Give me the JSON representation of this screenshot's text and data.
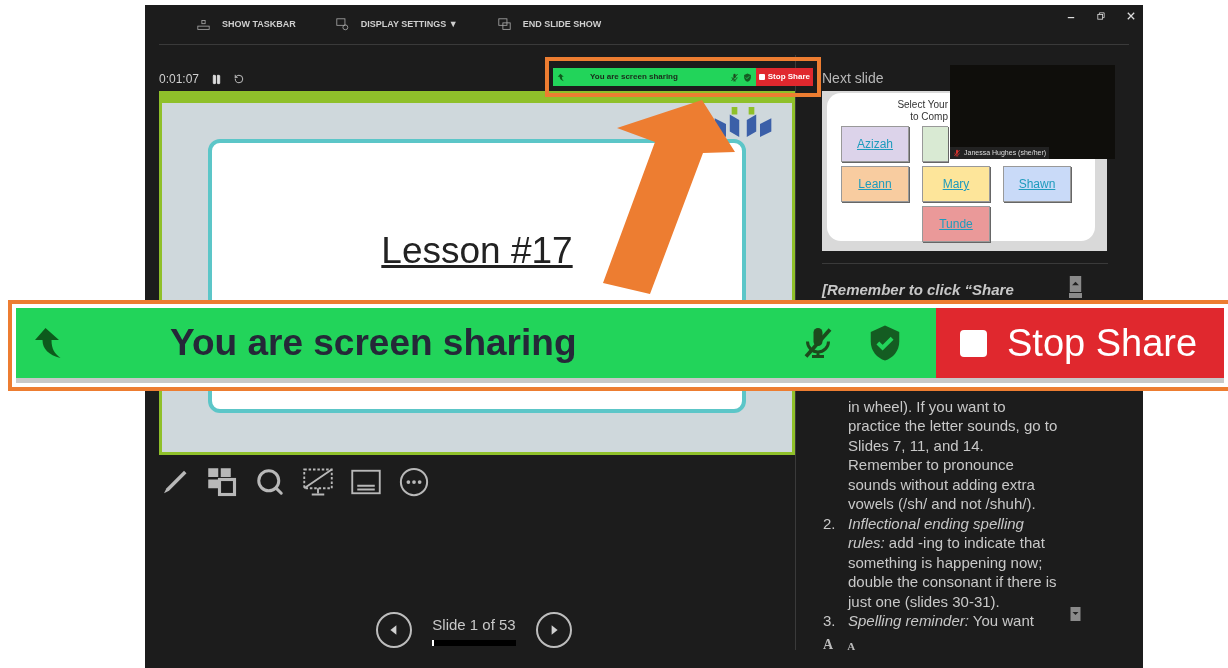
{
  "window": {
    "toolbar": [
      {
        "kind": "taskbar",
        "label": "SHOW TASKBAR"
      },
      {
        "kind": "display",
        "label": "DISPLAY SETTINGS ▼"
      },
      {
        "kind": "end",
        "label": "END SLIDE SHOW"
      }
    ]
  },
  "timer": {
    "time": "0:01:07"
  },
  "current_slide": {
    "title": "Lesson #17"
  },
  "navigation": {
    "label": "Slide 1 of 53",
    "level": 0.02
  },
  "next_slide": {
    "heading": "Next slide",
    "title_lines": [
      "Select Your",
      "to Comp"
    ],
    "rows": [
      [
        {
          "kind": "name",
          "label": "Azizah",
          "color": "#dcd3ea"
        },
        {
          "kind": "name",
          "color": "#d9ead3"
        }
      ],
      [
        {
          "kind": "name",
          "label": "Leann",
          "color": "#f8cca0"
        },
        {
          "kind": "name",
          "label": "Mary",
          "color": "#fde59a"
        },
        {
          "kind": "name",
          "label": "Shawn",
          "color": "#c9daf8"
        }
      ],
      [
        {
          "kind": "blank"
        },
        {
          "kind": "name",
          "label": "Tunde",
          "color": "#ea9999"
        }
      ]
    ]
  },
  "video": {
    "name": "Janessa Hughes (she/her)",
    "muted": true
  },
  "notes": [
    {
      "kind": "heading",
      "text": "[Remember to click “Share"
    },
    {
      "kind": "continuation",
      "text": "in wheel). If you want to practice the letter sounds, go to Slides 7, 11, and 14. Remember to pronounce sounds without adding extra vowels (/sh/ and not /shuh/)."
    },
    {
      "kind": "item",
      "number": "2.",
      "text": "*Inflectional ending spelling rules:* add -ing to indicate that something is happening now; double the consonant if there is just one (slides 30-31)."
    },
    {
      "kind": "item",
      "number": "3.",
      "text": "*Spelling reminder:* You want"
    }
  ],
  "font_buttons": [
    {
      "kind": "increase",
      "label": "A"
    },
    {
      "kind": "decrease",
      "label": "A"
    }
  ],
  "share_bar": {
    "status": "You are screen sharing",
    "action": "Stop Share",
    "mic_muted": true
  },
  "share_callout": {
    "status": "You are screen sharing",
    "action": "Stop Share",
    "mic_muted": true
  }
}
